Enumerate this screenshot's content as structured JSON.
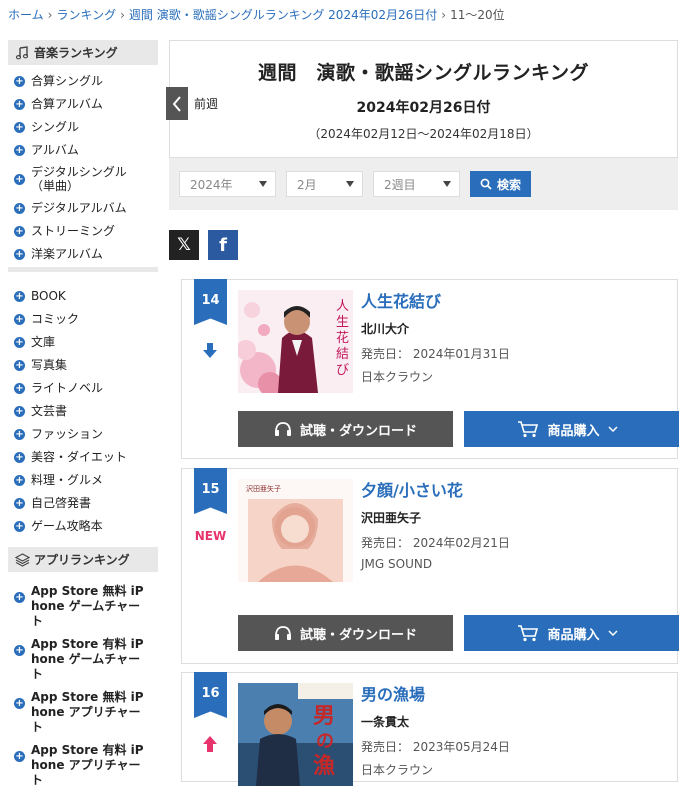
{
  "breadcrumb": {
    "home": "ホーム",
    "ranking": "ランキング",
    "weekly": "週間 演歌・歌謡シングルランキング 2024年02月26日付",
    "current": "11～20位"
  },
  "sidebar": {
    "music_heading": "音楽ランキング",
    "music_items": [
      "合算シングル",
      "合算アルバム",
      "シングル",
      "アルバム",
      "デジタルシングル（単曲）",
      "デジタルアルバム",
      "ストリーミング",
      "洋楽アルバム"
    ],
    "book_items": [
      "BOOK",
      "コミック",
      "文庫",
      "写真集",
      "ライトノベル",
      "文芸書",
      "ファッション",
      "美容・ダイエット",
      "料理・グルメ",
      "自己啓発書",
      "ゲーム攻略本"
    ],
    "app_heading": "アプリランキング",
    "app_items": [
      "App Store 無料 iPhone ゲームチャート",
      "App Store 有料 iPhone ゲームチャート",
      "App Store 無料 iPhone アプリチャート",
      "App Store 有料 iPhone アプリチャート"
    ]
  },
  "header": {
    "title": "週間　演歌・歌謡シングルランキング",
    "date": "2024年02月26日付",
    "range": "（2024年02月12日～2024年02月18日）",
    "prev_label": "前週"
  },
  "filters": {
    "year": "2024年",
    "month": "2月",
    "week": "2週目",
    "search_label": "検索"
  },
  "share": {
    "x_label": "𝕏",
    "fb_label": "f"
  },
  "buttons": {
    "listen": "試聴・ダウンロード",
    "buy": "商品購入"
  },
  "entries": [
    {
      "rank": "14",
      "trend": "down",
      "title": "人生花結び",
      "artist": "北川大介",
      "release": "発売日：  2024年01月31日",
      "label": "日本クラウン"
    },
    {
      "rank": "15",
      "trend": "new",
      "badge": "NEW",
      "title": "夕顔/小さい花",
      "artist": "沢田亜矢子",
      "release": "発売日：  2024年02月21日",
      "label": "JMG SOUND"
    },
    {
      "rank": "16",
      "trend": "up",
      "title": "男の漁場",
      "artist": "一条貫太",
      "release": "発売日：  2023年05月24日",
      "label": "日本クラウン"
    }
  ],
  "colors": {
    "accent": "#2a6ebb",
    "new": "#e8336d",
    "trend": "#2a6ebb",
    "up": "#e8336d"
  }
}
